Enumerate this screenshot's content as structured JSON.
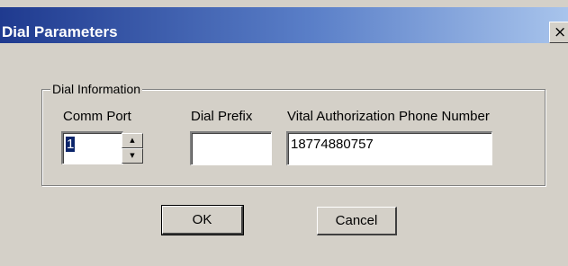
{
  "window": {
    "title": "Dial Parameters",
    "close_glyph": "×"
  },
  "group": {
    "legend": "Dial Information"
  },
  "comm_port": {
    "label": "Comm Port",
    "value": "1",
    "up_glyph": "▲",
    "down_glyph": "▼"
  },
  "dial_prefix": {
    "label": "Dial Prefix",
    "value": ""
  },
  "phone_number": {
    "label": "Vital Authorization Phone Number",
    "value": "18774880757"
  },
  "buttons": {
    "ok": "OK",
    "cancel": "Cancel"
  },
  "colors": {
    "title_gradient_start": "#1f3a8f",
    "title_gradient_end": "#a8c4ec",
    "dialog_face": "#d4d0c8",
    "selection": "#0a246a"
  }
}
